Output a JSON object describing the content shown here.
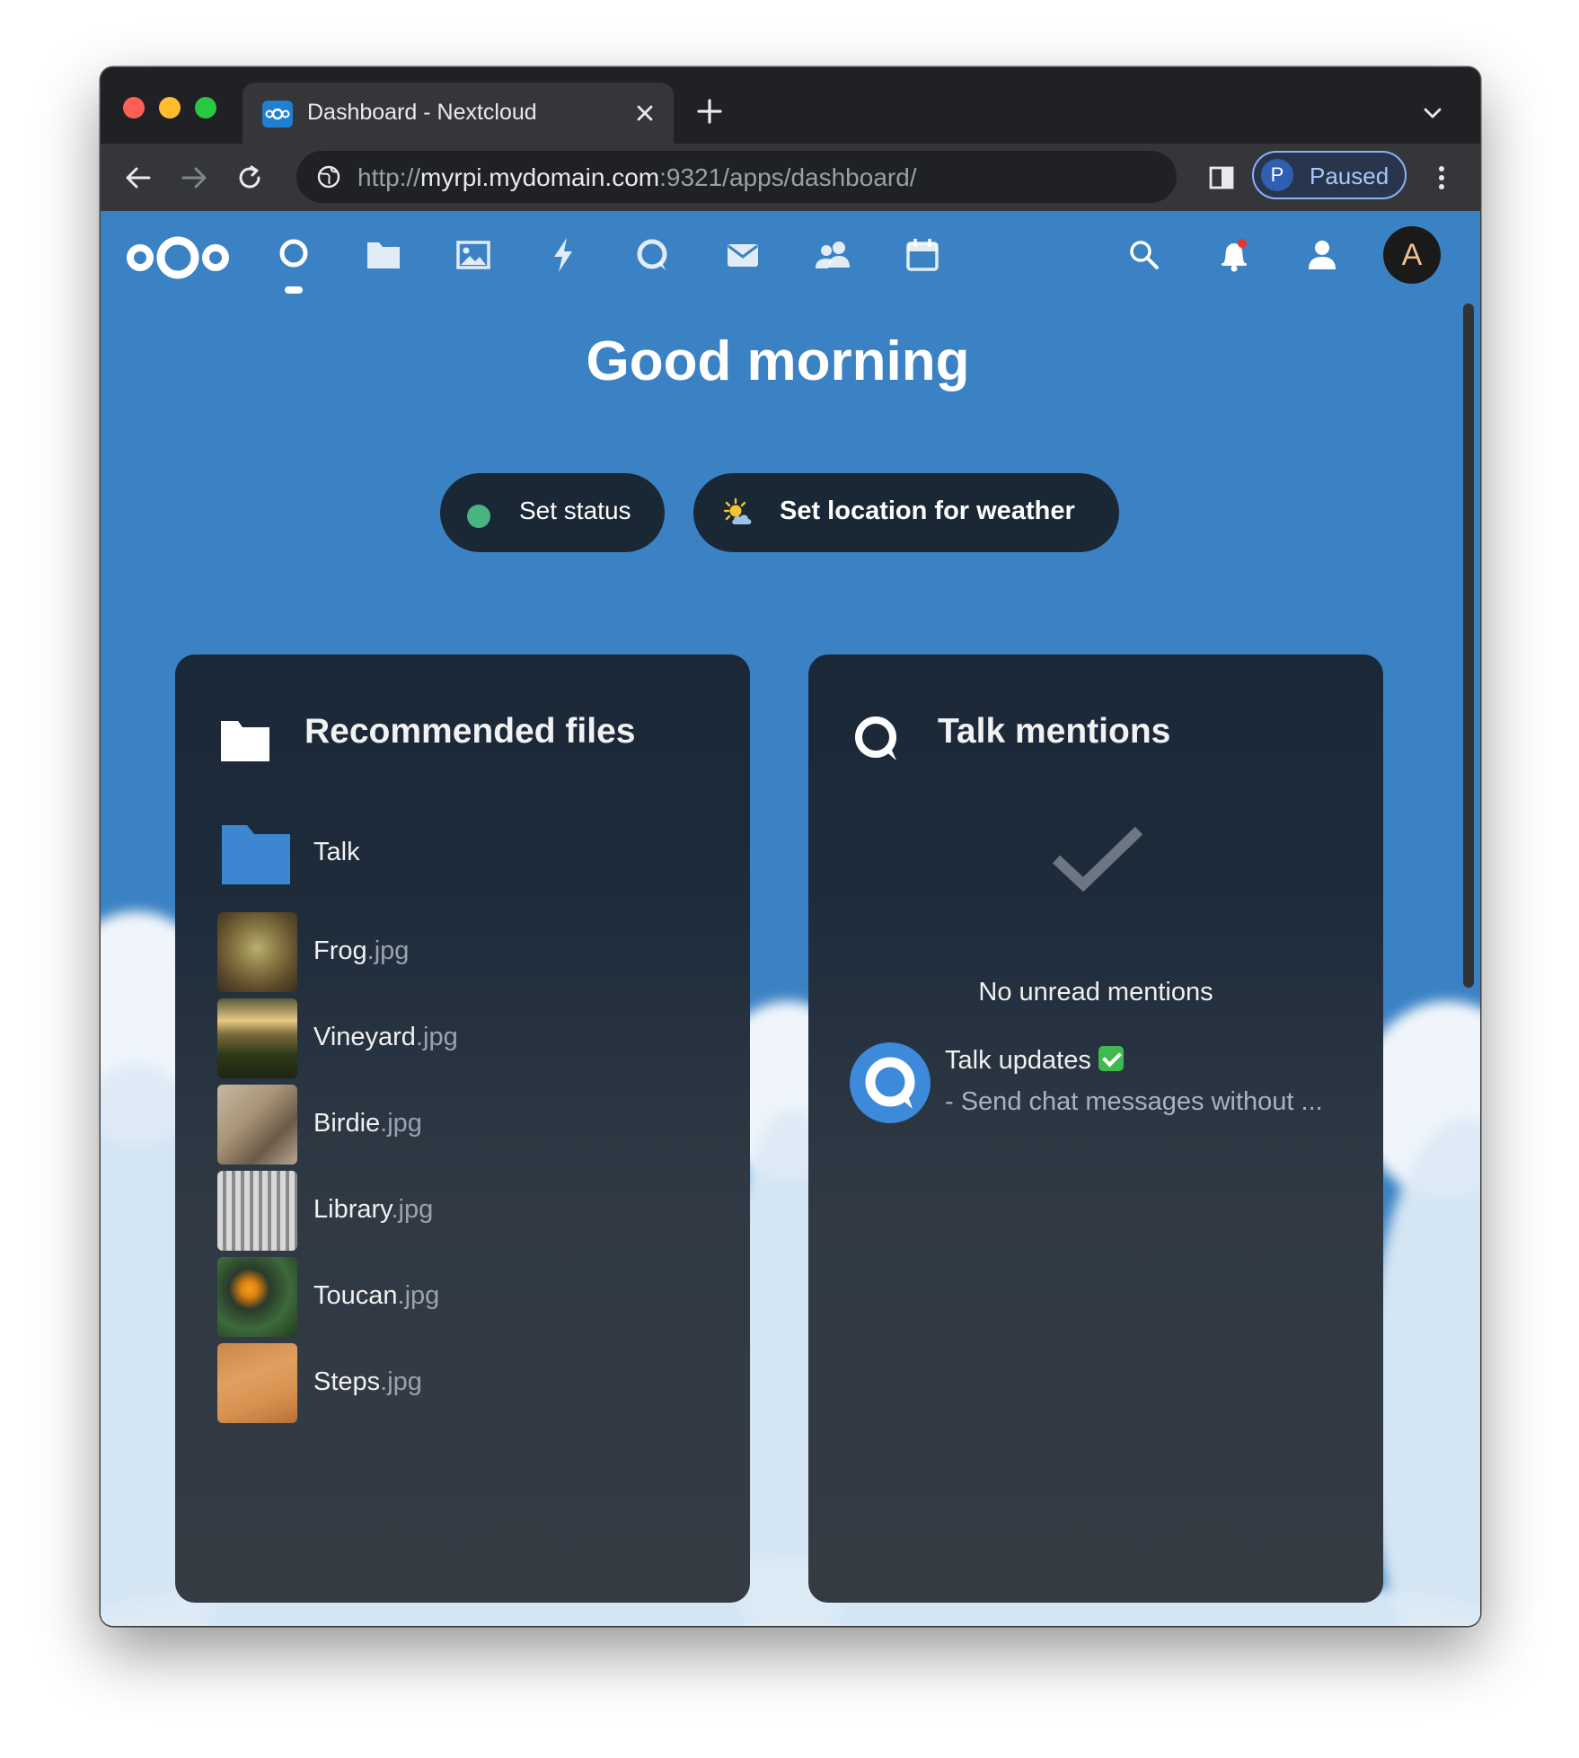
{
  "browser": {
    "tab_title": "Dashboard - Nextcloud",
    "url_scheme": "http://",
    "url_host": "myrpi.mydomain.com",
    "url_rest": ":9321/apps/dashboard/",
    "profile_initial": "P",
    "profile_status": "Paused"
  },
  "header": {
    "apps": [
      "dashboard-icon",
      "files-icon",
      "photos-icon",
      "activity-icon",
      "talk-icon",
      "mail-icon",
      "contacts-icon",
      "calendar-icon"
    ],
    "user_initial": "A"
  },
  "greeting": "Good morning",
  "actions": {
    "status_label": "Set status",
    "weather_label": "Set location for weather"
  },
  "recommended": {
    "title": "Recommended files",
    "items": [
      {
        "base": "Talk",
        "ext": "",
        "kind": "folder"
      },
      {
        "base": "Frog",
        "ext": ".jpg",
        "kind": "image"
      },
      {
        "base": "Vineyard",
        "ext": ".jpg",
        "kind": "image"
      },
      {
        "base": "Birdie",
        "ext": ".jpg",
        "kind": "image"
      },
      {
        "base": "Library",
        "ext": ".jpg",
        "kind": "image"
      },
      {
        "base": "Toucan",
        "ext": ".jpg",
        "kind": "image"
      },
      {
        "base": "Steps",
        "ext": ".jpg",
        "kind": "image"
      }
    ]
  },
  "talk": {
    "title": "Talk mentions",
    "empty_text": "No unread mentions",
    "item_title": "Talk updates",
    "item_subtitle": "- Send chat messages without ..."
  },
  "colors": {
    "accent": "#3b82c4",
    "panel": "#1a2838",
    "status_online": "#49b382"
  }
}
